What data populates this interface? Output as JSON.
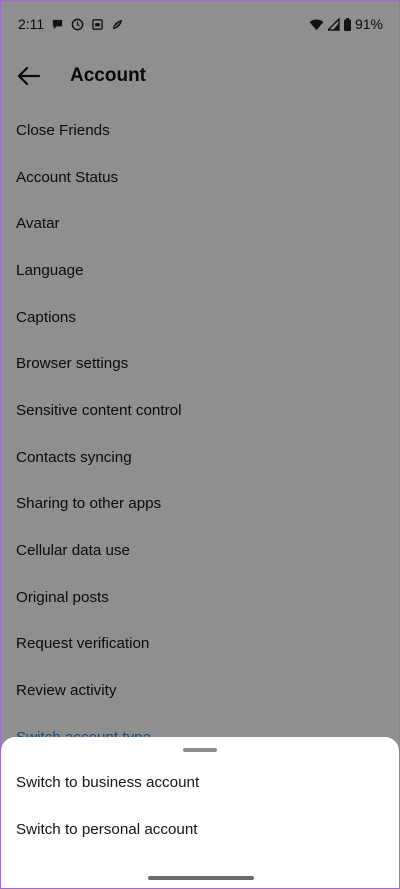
{
  "status_bar": {
    "time": "2:11",
    "battery": "91%",
    "icons": [
      "chat-bubble-icon",
      "clock-icon",
      "shield-app-icon",
      "leaf-app-icon",
      "wifi-icon",
      "signal-icon",
      "battery-icon"
    ]
  },
  "header": {
    "title": "Account",
    "back_icon": "arrow-left-icon"
  },
  "menu": {
    "items": [
      "Close Friends",
      "Account Status",
      "Avatar",
      "Language",
      "Captions",
      "Browser settings",
      "Sensitive content control",
      "Contacts syncing",
      "Sharing to other apps",
      "Cellular data use",
      "Original posts",
      "Request verification",
      "Review activity",
      "Switch account type"
    ]
  },
  "sheet": {
    "options": [
      "Switch to business account",
      "Switch to personal account"
    ]
  },
  "colors": {
    "link": "#2f7fd0",
    "scrim": "rgba(0,0,0,0.44)",
    "border": "#9a6fc4"
  }
}
